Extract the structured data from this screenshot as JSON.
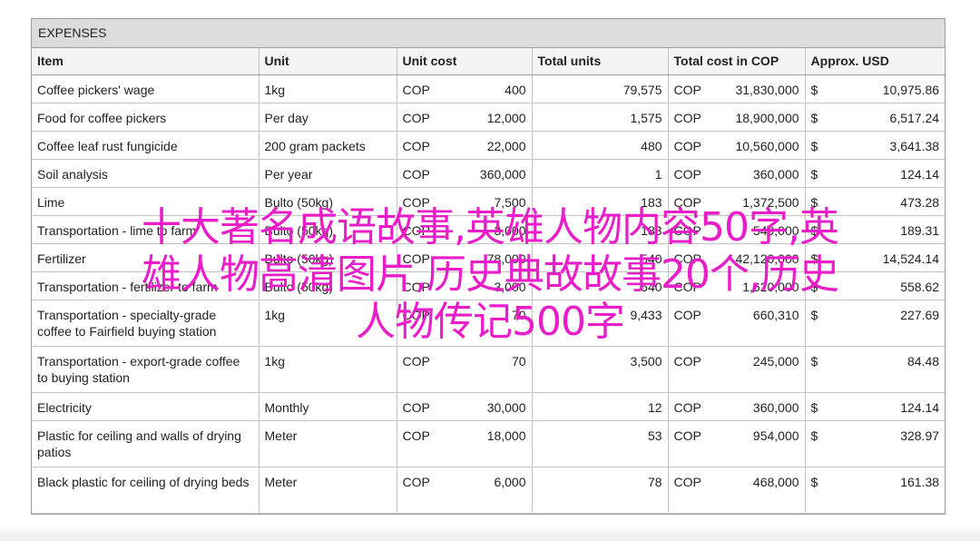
{
  "section_title": "EXPENSES",
  "columns": [
    "Item",
    "Unit",
    "Unit cost",
    "Total units",
    "Total cost in COP",
    "Approx. USD"
  ],
  "rows": [
    {
      "item": "Coffee pickers' wage",
      "unit": "1kg",
      "cur1": "COP",
      "unit_cost": "400",
      "total_units": "79,575",
      "cur2": "COP",
      "total_cost": "31,830,000",
      "cur3": "$",
      "usd": "10,975.86"
    },
    {
      "item": "Food for coffee pickers",
      "unit": "Per day",
      "cur1": "COP",
      "unit_cost": "12,000",
      "total_units": "1,575",
      "cur2": "COP",
      "total_cost": "18,900,000",
      "cur3": "$",
      "usd": "6,517.24"
    },
    {
      "item": "Coffee leaf rust fungicide",
      "unit": "200 gram packets",
      "cur1": "COP",
      "unit_cost": "22,000",
      "total_units": "480",
      "cur2": "COP",
      "total_cost": "10,560,000",
      "cur3": "$",
      "usd": "3,641.38"
    },
    {
      "item": "Soil analysis",
      "unit": "Per year",
      "cur1": "COP",
      "unit_cost": "360,000",
      "total_units": "1",
      "cur2": "COP",
      "total_cost": "360,000",
      "cur3": "$",
      "usd": "124.14"
    },
    {
      "item": "Lime",
      "unit": "Bulto (50kg)",
      "cur1": "COP",
      "unit_cost": "7,500",
      "total_units": "183",
      "cur2": "COP",
      "total_cost": "1,372,500",
      "cur3": "$",
      "usd": "473.28"
    },
    {
      "item": "Transportation - lime to farm",
      "unit": "Bulto (50kg)",
      "cur1": "COP",
      "unit_cost": "3,000",
      "total_units": "183",
      "cur2": "COP",
      "total_cost": "549,000",
      "cur3": "$",
      "usd": "189.31"
    },
    {
      "item": "Fertilizer",
      "unit": "Bulto (50kg)",
      "cur1": "COP",
      "unit_cost": "78,000",
      "total_units": "540",
      "cur2": "COP",
      "total_cost": "42,120,000",
      "cur3": "$",
      "usd": "14,524.14"
    },
    {
      "item": "Transportation - fertilizer to farm",
      "unit": "Bulto (50kg)",
      "cur1": "COP",
      "unit_cost": "3,000",
      "total_units": "540",
      "cur2": "COP",
      "total_cost": "1,620,000",
      "cur3": "$",
      "usd": "558.62"
    },
    {
      "item": "Transportation - specialty-grade coffee to Fairfield buying station",
      "unit": "1kg",
      "cur1": "COP",
      "unit_cost": "70",
      "total_units": "9,433",
      "cur2": "COP",
      "total_cost": "660,310",
      "cur3": "$",
      "usd": "227.69"
    },
    {
      "item": "Transportation - export-grade coffee to buying station",
      "unit": "1kg",
      "cur1": "COP",
      "unit_cost": "70",
      "total_units": "3,500",
      "cur2": "COP",
      "total_cost": "245,000",
      "cur3": "$",
      "usd": "84.48"
    },
    {
      "item": "Electricity",
      "unit": "Monthly",
      "cur1": "COP",
      "unit_cost": "30,000",
      "total_units": "12",
      "cur2": "COP",
      "total_cost": "360,000",
      "cur3": "$",
      "usd": "124.14"
    },
    {
      "item": "Plastic for ceiling and walls of drying patios",
      "unit": "Meter",
      "cur1": "COP",
      "unit_cost": "18,000",
      "total_units": "53",
      "cur2": "COP",
      "total_cost": "954,000",
      "cur3": "$",
      "usd": "328.97"
    },
    {
      "item": "Black plastic for ceiling of drying beds",
      "unit": "Meter",
      "cur1": "COP",
      "unit_cost": "6,000",
      "total_units": "78",
      "cur2": "COP",
      "total_cost": "468,000",
      "cur3": "$",
      "usd": "161.38"
    }
  ],
  "overlay_lines": [
    "十大著名成语故事,英雄人物内容50字,英",
    "雄人物高清图片,历史典故故事20个,历史",
    "人物传记500字"
  ]
}
